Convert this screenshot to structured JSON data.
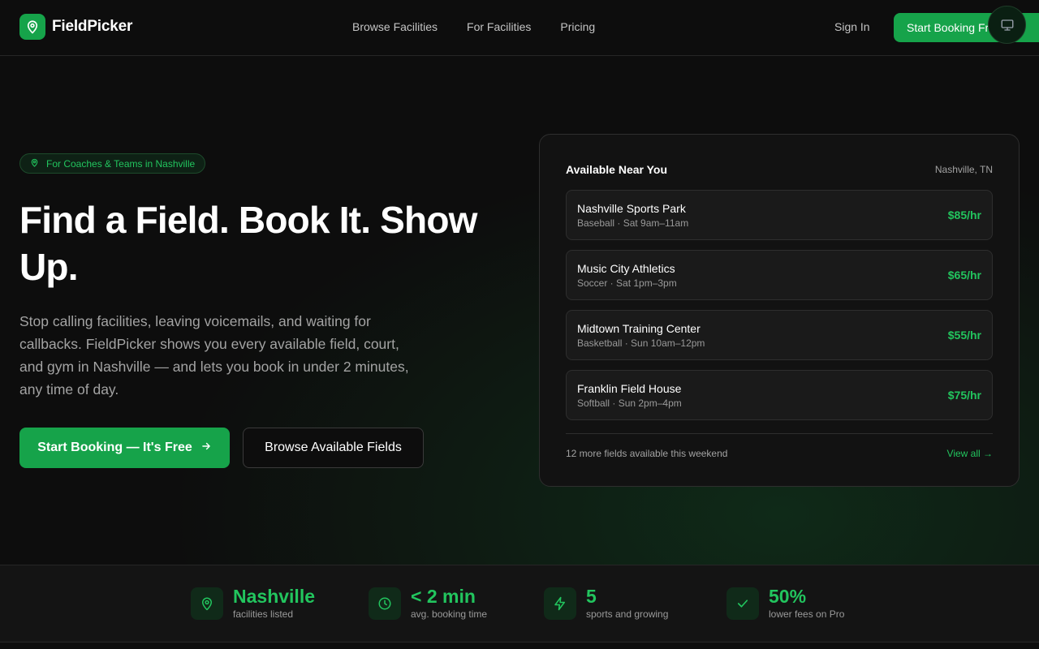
{
  "brand": {
    "name": "FieldPicker",
    "accent": "#16a34a",
    "accent_text": "#22c55e"
  },
  "nav": {
    "links": [
      "Browse Facilities",
      "For Facilities",
      "Pricing"
    ],
    "sign_in": "Sign In",
    "cta": "Start Booking Free"
  },
  "hero": {
    "badge": "For Coaches & Teams in Nashville",
    "headline": "Find a Field. Book It. Show Up.",
    "description": "Stop calling facilities, leaving voicemails, and waiting for callbacks. FieldPicker shows you every available field, court, and gym in Nashville — and lets you book in under 2 minutes, any time of day.",
    "primary_button": "Start Booking — It's Free",
    "secondary_button": "Browse Available Fields"
  },
  "card": {
    "title": "Available Near You",
    "location": "Nashville, TN",
    "facilities": [
      {
        "name": "Nashville Sports Park",
        "meta": "Baseball · Sat 9am–11am",
        "price": "$85/hr"
      },
      {
        "name": "Music City Athletics",
        "meta": "Soccer · Sat 1pm–3pm",
        "price": "$65/hr"
      },
      {
        "name": "Midtown Training Center",
        "meta": "Basketball · Sun 10am–12pm",
        "price": "$55/hr"
      },
      {
        "name": "Franklin Field House",
        "meta": "Softball · Sun 2pm–4pm",
        "price": "$75/hr"
      }
    ],
    "more_text": "12 more fields available this weekend",
    "view_all": "View all →"
  },
  "stats": [
    {
      "icon": "map-pin-icon",
      "value": "Nashville",
      "label": "facilities listed"
    },
    {
      "icon": "clock-icon",
      "value": "< 2 min",
      "label": "avg. booking time"
    },
    {
      "icon": "lightning-icon",
      "value": "5",
      "label": "sports and growing"
    },
    {
      "icon": "check-icon",
      "value": "50%",
      "label": "lower fees on Pro"
    }
  ]
}
